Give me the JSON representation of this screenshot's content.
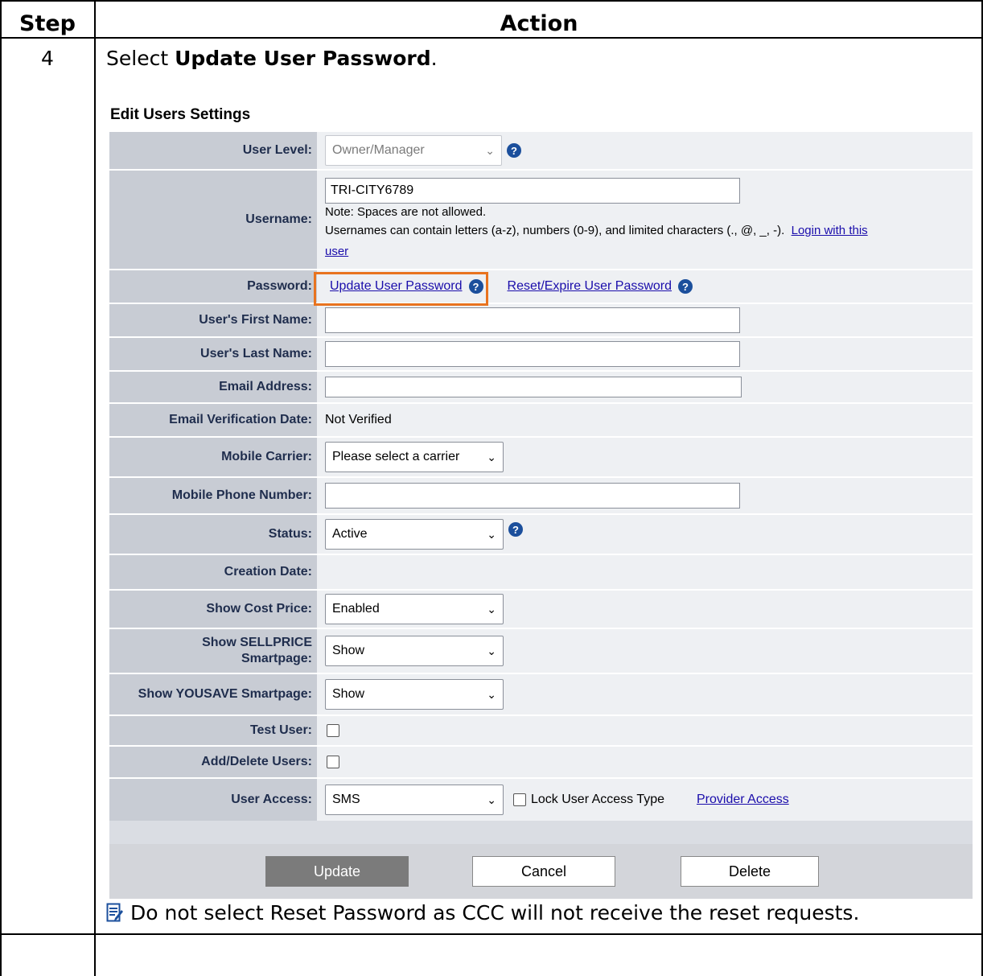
{
  "doc": {
    "header_step": "Step",
    "header_action": "Action",
    "step_number": "4",
    "instruction_prefix": "Select ",
    "instruction_bold": "Update User Password",
    "instruction_suffix": ".",
    "note": "Do not select Reset Password as CCC will not receive the reset requests."
  },
  "screen": {
    "title": "Edit Users Settings",
    "user_level": {
      "label": "User Level:",
      "value": "Owner/Manager"
    },
    "username": {
      "label": "Username:",
      "value": "TRI-CITY6789",
      "note1": "Note: Spaces are not allowed.",
      "note2": "Usernames can contain letters (a-z), numbers (0-9), and limited characters (., @, _, -).",
      "login_link_a": "Login with this",
      "login_link_b": "user"
    },
    "password": {
      "label": "Password:",
      "update_link": "Update User Password",
      "reset_link": "Reset/Expire User Password"
    },
    "first_name": {
      "label": "User's First Name:",
      "value": ""
    },
    "last_name": {
      "label": "User's Last Name:",
      "value": ""
    },
    "email": {
      "label": "Email Address:",
      "value": ""
    },
    "email_verif": {
      "label": "Email Verification Date:",
      "value": "Not Verified"
    },
    "mobile_carrier": {
      "label": "Mobile Carrier:",
      "value": "Please select a carrier"
    },
    "mobile_phone": {
      "label": "Mobile Phone Number:",
      "value": ""
    },
    "status": {
      "label": "Status:",
      "value": "Active"
    },
    "creation_date": {
      "label": "Creation Date:",
      "value": ""
    },
    "show_cost": {
      "label": "Show Cost Price:",
      "value": "Enabled"
    },
    "show_sellprice": {
      "label_a": "Show SELLPRICE",
      "label_b": "Smartpage:",
      "value": "Show"
    },
    "show_yousave": {
      "label": "Show YOUSAVE Smartpage:",
      "value": "Show"
    },
    "test_user": {
      "label": "Test User:",
      "checked": false
    },
    "add_delete": {
      "label": "Add/Delete Users:",
      "checked": false
    },
    "user_access": {
      "label": "User Access:",
      "value": "SMS",
      "lock_label": "Lock User Access Type",
      "provider_link": "Provider Access"
    },
    "buttons": {
      "update": "Update",
      "cancel": "Cancel",
      "delete": "Delete"
    }
  },
  "colors": {
    "highlight": "#e8731f",
    "link": "#1a0dab",
    "help_icon": "#1b4f9c"
  }
}
